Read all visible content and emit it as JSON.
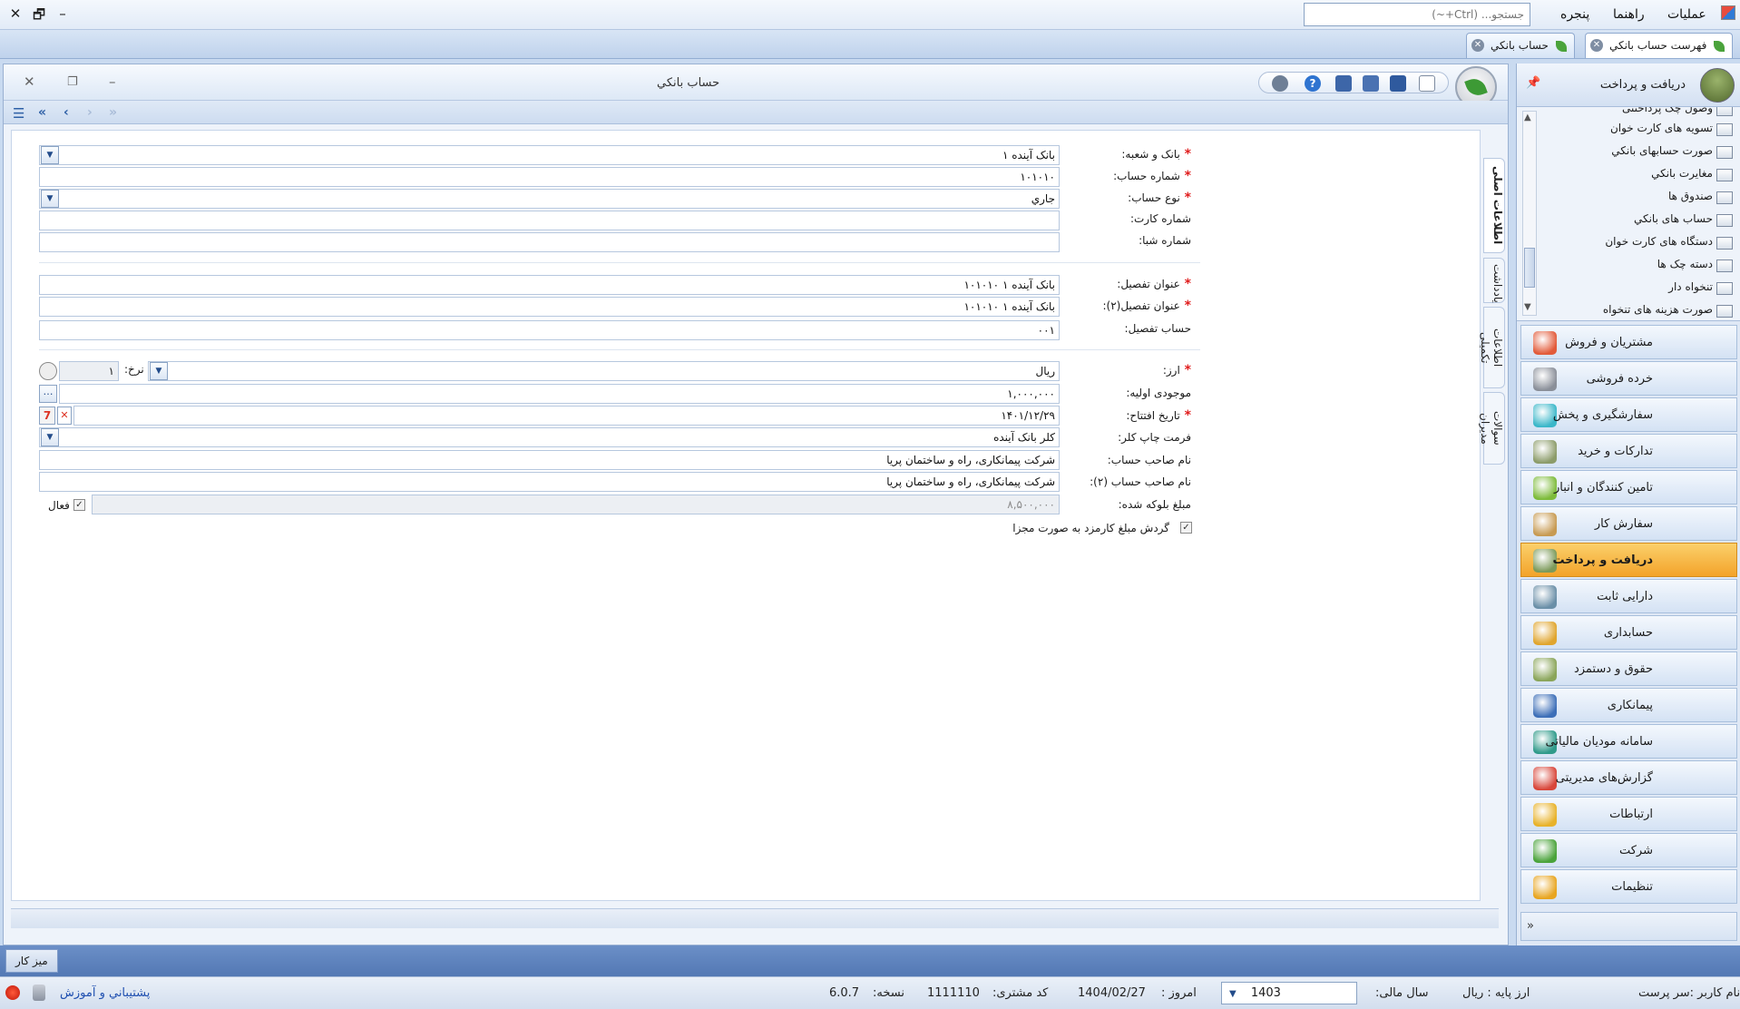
{
  "menubar": {
    "menu": [
      "عمليات",
      "راهنما",
      "پنجره"
    ],
    "search_placeholder": "جستجو... (Ctrl+~)",
    "window_controls": {
      "close": "✕",
      "restore": "🗗",
      "minimize": "–"
    }
  },
  "doc_tabs": [
    {
      "label": "فهرست حساب بانکي"
    },
    {
      "label": "حساب بانکي"
    }
  ],
  "form": {
    "title": "حساب بانکي",
    "window_controls": {
      "close": "✕",
      "restore": "❐",
      "minimize": "–"
    },
    "side_tabs": [
      "اطلاعات اصلی",
      "یادداشت",
      "اطلاعات تکمیلی",
      "سوالات مدیران"
    ],
    "fields": {
      "bank_branch": {
        "label": "بانک و شعبه:",
        "value": "بانک آينده ۱"
      },
      "account_number": {
        "label": "شماره حساب:",
        "value": "۱۰۱۰۱۰"
      },
      "account_type": {
        "label": "نوع حساب:",
        "value": "جاري"
      },
      "card_number": {
        "label": "شماره کارت:",
        "value": ""
      },
      "sheba_number": {
        "label": "شماره شبا:",
        "value": ""
      },
      "detail_title": {
        "label": "عنوان تفصيل:",
        "value": "بانک آينده ۱ ۱۰۱۰۱۰"
      },
      "detail_title2": {
        "label": "عنوان تفصيل(۲):",
        "value": "بانک آينده ۱ ۱۰۱۰۱۰"
      },
      "detail_account": {
        "label": "حساب تفصيل:",
        "value": "۰۰۱"
      },
      "currency": {
        "label": "ارز:",
        "value": "ريال"
      },
      "rate": {
        "label": "نرخ:",
        "value": "۱"
      },
      "initial_balance": {
        "label": "موجودی اوليه:",
        "value": "۱,۰۰۰,۰۰۰"
      },
      "opening_date": {
        "label": "تاريخ افتتاح:",
        "value": "۱۴۰۱/۱۲/۲۹"
      },
      "check_print_format": {
        "label": "فرمت چاپ کلر:",
        "value": "کلر بانک آينده"
      },
      "owner_name": {
        "label": "نام صاحب حساب:",
        "value": "شرکت پيمانکاری، راه و ساختمان پريا"
      },
      "owner_name2": {
        "label": "نام صاحب حساب (۲):",
        "value": "شرکت پيمانکاری، راه و ساختمان پريا"
      },
      "blocked_amount": {
        "label": "مبلغ بلوکه شده:",
        "value": "۸,۵۰۰,۰۰۰"
      }
    },
    "active_label": "فعال",
    "active_checked": true,
    "fee_rounding_label": "گردش مبلغ کارمزد به صورت مجزا",
    "fee_rounding_checked": true
  },
  "nav_panel": {
    "header": "دريافت و پرداخت",
    "sub_items": [
      "وصول چک پرداختنی",
      "تسويه های کارت خوان",
      "صورت حسابهای بانکي",
      "مغايرت بانکي",
      "صندوق ها",
      "حساب های بانکي",
      "دستگاه های کارت خوان",
      "دسته چک ها",
      "تنخواه دار",
      "صورت هزينه های تنخواه"
    ],
    "modules": [
      {
        "label": "مشتريان و فروش",
        "color": "#e25b3a"
      },
      {
        "label": "خرده فروشی",
        "color": "#8a8f99"
      },
      {
        "label": "سفارشگيری و پخش",
        "color": "#3bb7c9"
      },
      {
        "label": "تدارکات و خريد",
        "color": "#8c9c6a"
      },
      {
        "label": "تامين کنندگان و انبار",
        "color": "#7dbb3a"
      },
      {
        "label": "سفارش کار",
        "color": "#c79a52"
      },
      {
        "label": "دريافت و پرداخت",
        "color": "#7c9a5a",
        "active": true
      },
      {
        "label": "دارايی ثابت",
        "color": "#6a8fa8"
      },
      {
        "label": "حسابداری",
        "color": "#e0a52e"
      },
      {
        "label": "حقوق و دستمزد",
        "color": "#8aa55a"
      },
      {
        "label": "پيمانکاری",
        "color": "#3d6fb8"
      },
      {
        "label": "سامانه موديان مالياتی",
        "color": "#2f9a8a"
      },
      {
        "label": "گزارش‌های مديريتی",
        "color": "#d8463a"
      },
      {
        "label": "ارتباطات",
        "color": "#e8b22a"
      },
      {
        "label": "شرکت",
        "color": "#4aa33b"
      },
      {
        "label": "تنظيمات",
        "color": "#e8a520"
      }
    ]
  },
  "desk_tab": "ميز کار",
  "statusbar": {
    "user": "نام کاربر :سر پرست",
    "base_currency": "ارز پايه :   ريال",
    "fiscal_year_label": "سال مالی:",
    "fiscal_year": "1403",
    "today_label": "امروز :",
    "today": "1404/02/27",
    "customer_code_label": "کد مشتری:",
    "customer_code": "1111110",
    "version_label": "نسخه:",
    "version": "6.0.7",
    "support": "پشتيباني و آموزش"
  }
}
